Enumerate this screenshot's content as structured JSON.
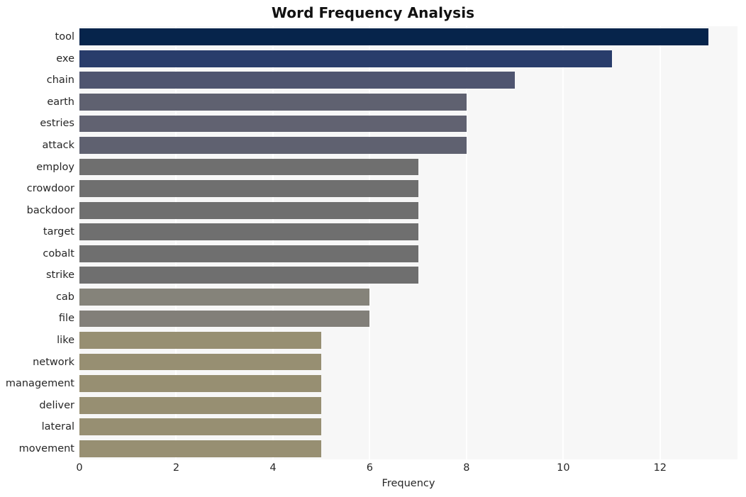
{
  "chart_data": {
    "type": "bar",
    "orientation": "horizontal",
    "title": "Word Frequency Analysis",
    "xlabel": "Frequency",
    "ylabel": "",
    "categories": [
      "tool",
      "exe",
      "chain",
      "earth",
      "estries",
      "attack",
      "employ",
      "crowdoor",
      "backdoor",
      "target",
      "cobalt",
      "strike",
      "cab",
      "file",
      "like",
      "network",
      "management",
      "deliver",
      "lateral",
      "movement"
    ],
    "values": [
      13,
      11,
      9,
      8,
      8,
      8,
      7,
      7,
      7,
      7,
      7,
      7,
      6,
      6,
      5,
      5,
      5,
      5,
      5,
      5
    ],
    "bar_colors": [
      "#06244b",
      "#293d6b",
      "#4f5570",
      "#5f6170",
      "#616271",
      "#5f6170",
      "#6f6f6f",
      "#6f6f6f",
      "#6f6f6f",
      "#6f6f6f",
      "#6f6f6f",
      "#6f6f6f",
      "#85837a",
      "#827f79",
      "#978f72",
      "#978f72",
      "#978f72",
      "#978f72",
      "#978f72",
      "#978f72"
    ],
    "xlim": [
      0,
      13.6
    ],
    "x_ticks": [
      "0",
      "2",
      "4",
      "6",
      "8",
      "10",
      "12"
    ],
    "x_tick_values": [
      0,
      2,
      4,
      6,
      8,
      10,
      12
    ],
    "grid": true,
    "grid_axis": "x",
    "grid_color": "#ffffff",
    "plot_background": "#f7f7f7",
    "figure_background": "#ffffff",
    "legend": null
  }
}
